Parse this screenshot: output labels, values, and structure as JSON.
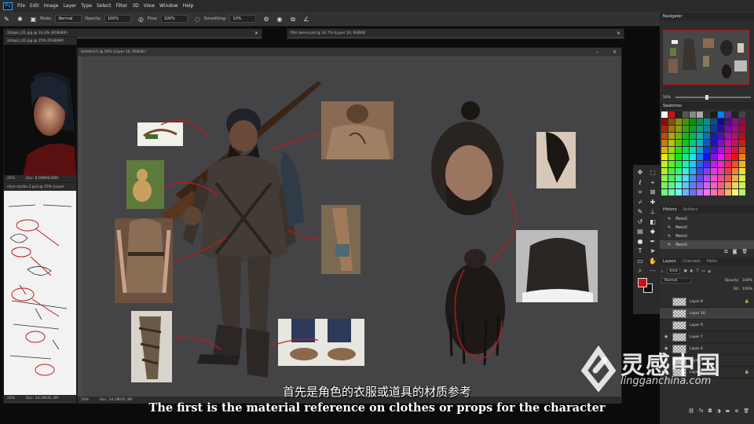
{
  "menu": {
    "app_icon": "Ps",
    "items": [
      "File",
      "Edit",
      "Image",
      "Layer",
      "Type",
      "Select",
      "Filter",
      "3D",
      "View",
      "Window",
      "Help"
    ]
  },
  "options": {
    "mode_label": "Mode:",
    "mode_value": "Normal",
    "opacity_label": "Opacity:",
    "opacity_value": "100%",
    "flow_label": "Flow:",
    "flow_value": "100%",
    "smoothing_label": "Smoothing:",
    "smoothing_value": "10%"
  },
  "docs": {
    "doc1_title": "2d(api)_01.jpg @ 33.3% (RGB/8#)",
    "doc2_title": "2d(api)_02.jpg @ 25% (RGB/8#)",
    "doc3_title": "film demo.psd @ 16.7% (Layer 10, RGB/8)",
    "doc4_title": "ellya studio 2.psd @ 25% (Layer",
    "doc2_zoom": "25%",
    "doc2_size": "Doc: 8.00M/8.00M",
    "doc4_zoom": "25%",
    "doc4_size": "Doc: 34.2M/45.3M"
  },
  "main": {
    "title": "Untitled-1 @ 50% (Layer 10, RGB/8) *",
    "zoom": "50%",
    "doc_size": "Doc: 34.2M/45.3M"
  },
  "navigator": {
    "tab": "Navigator",
    "zoom": "50%"
  },
  "swatches": {
    "tab": "Swatches"
  },
  "history": {
    "tabs": [
      "History",
      "Actions"
    ],
    "items": [
      "Pencil",
      "Pencil",
      "Pencil",
      "Pencil"
    ]
  },
  "layers": {
    "tabs": [
      "Layers",
      "Channels",
      "Paths"
    ],
    "kind": "Kind",
    "blend": "Normal",
    "opacity_label": "Opacity:",
    "opacity": "100%",
    "fill_label": "Fill:",
    "fill": "100%",
    "items": [
      "Layer 8",
      "Layer 10",
      "Layer 9",
      "Layer 7",
      "Layer 4",
      "Layer 3",
      "Layer 1"
    ]
  },
  "subtitle": {
    "zh": "首先是角色的衣服或道具的材质参考",
    "en": "The first is the material reference on clothes or props for the character"
  },
  "watermark": {
    "cn": "灵感中国",
    "en": "lingganchina.com"
  },
  "colors": {
    "foreground": "#d01010",
    "background": "#111111",
    "annotation": "#c21a1a",
    "ps_blue": "#31a8ff"
  },
  "icons": {
    "tools": [
      "move-icon",
      "marquee-icon",
      "lasso-icon",
      "quick-select-icon",
      "crop-icon",
      "frame-icon",
      "eyedropper-icon",
      "healing-icon",
      "brush-icon",
      "stamp-icon",
      "history-brush-icon",
      "eraser-icon",
      "gradient-icon",
      "blur-icon",
      "dodge-icon",
      "pen-icon",
      "type-icon",
      "path-select-icon",
      "shape-icon",
      "hand-icon",
      "zoom-icon",
      "more-icon"
    ]
  }
}
